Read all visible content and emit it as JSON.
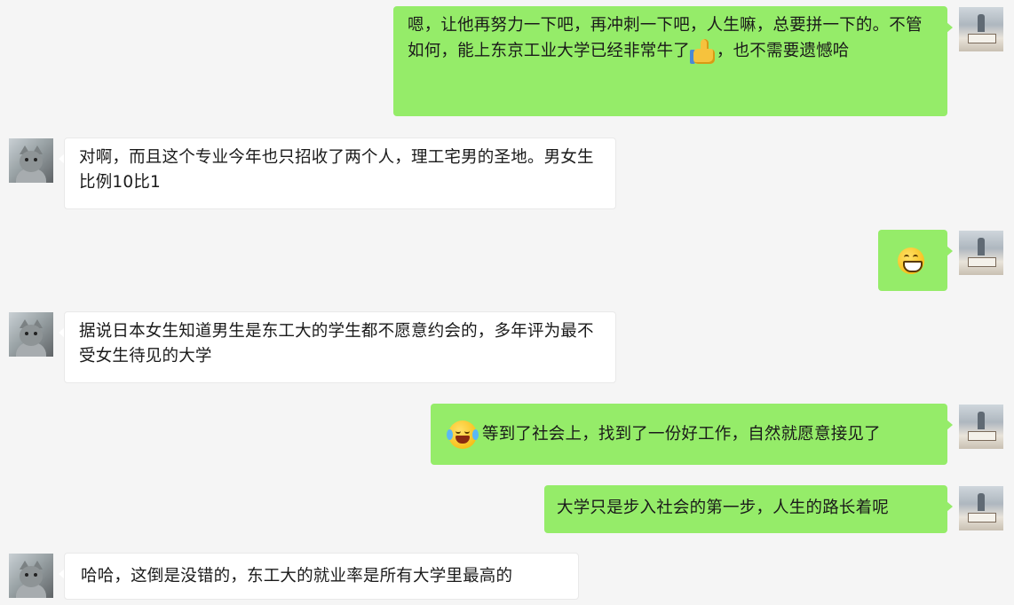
{
  "messages": [
    {
      "side": "me",
      "text_before": "嗯，让他再努力一下吧，再冲刺一下吧，人生嘛，总要拼一下的。不管如何，能上东京工业大学已经非常牛了",
      "emoji": "thumbs-up",
      "text_after": "，也不需要遗憾哈"
    },
    {
      "side": "other",
      "text": "对啊，而且这个专业今年也只招收了两个人，理工宅男的圣地。男女生比例10比1"
    },
    {
      "side": "me",
      "emoji": "grinning-face"
    },
    {
      "side": "other",
      "text": "据说日本女生知道男生是东工大的学生都不愿意约会的，多年评为最不受女生待见的大学"
    },
    {
      "side": "me",
      "emoji": "tears-of-joy",
      "text": "等到了社会上，找到了一份好工作，自然就愿意接见了"
    },
    {
      "side": "me",
      "text": "大学只是步入社会的第一步，人生的路长着呢"
    },
    {
      "side": "other",
      "text": "哈哈，这倒是没错的，东工大的就业率是所有大学里最高的"
    }
  ],
  "colors": {
    "background": "#f5f5f5",
    "my_bubble": "#95ec69",
    "their_bubble": "#ffffff"
  }
}
